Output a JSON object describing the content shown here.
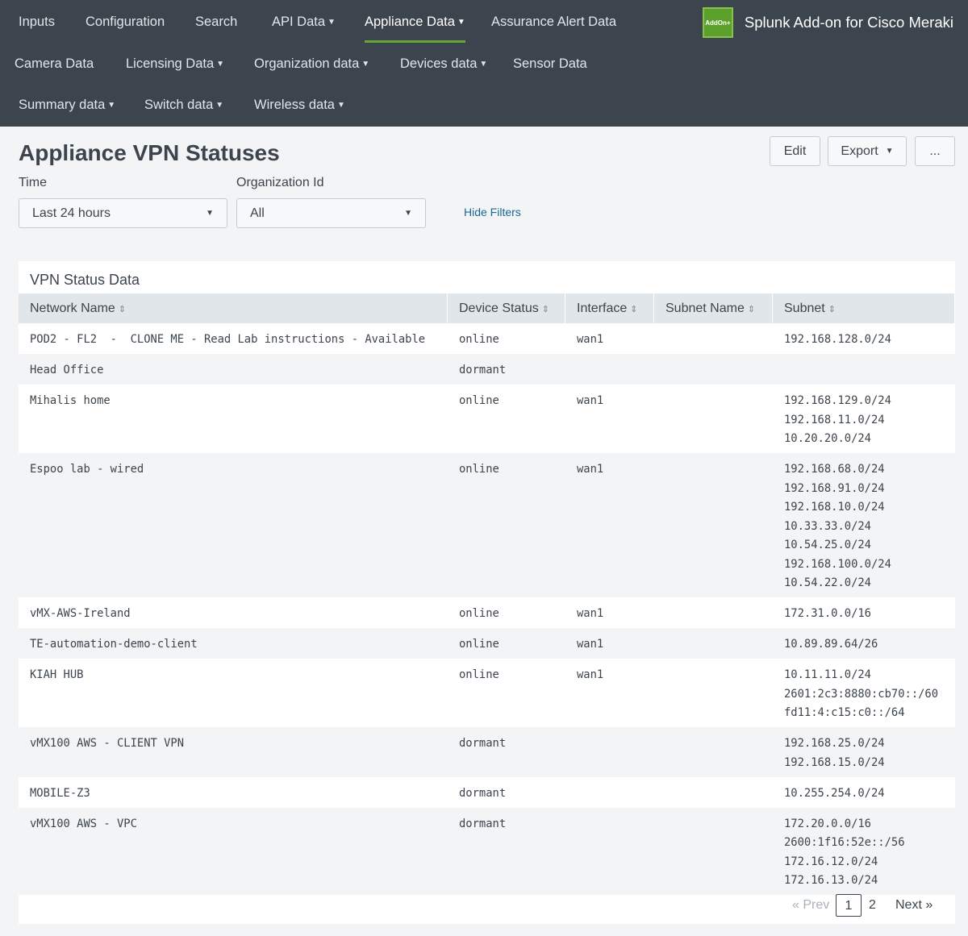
{
  "nav": {
    "row1": [
      {
        "label": "Inputs",
        "caret": false
      },
      {
        "label": "Configuration",
        "caret": false
      },
      {
        "label": "Search",
        "caret": false
      },
      {
        "label": "API Data",
        "caret": true
      },
      {
        "label": "Appliance Data",
        "caret": true,
        "active": true
      },
      {
        "label": "Assurance Alert Data",
        "caret": false
      }
    ],
    "row2": [
      {
        "label": "Camera Data",
        "caret": false
      },
      {
        "label": "Licensing Data",
        "caret": true
      },
      {
        "label": "Organization data",
        "caret": true
      },
      {
        "label": "Devices data",
        "caret": true
      },
      {
        "label": "Sensor Data",
        "caret": false
      }
    ],
    "row3": [
      {
        "label": "Summary data",
        "caret": true
      },
      {
        "label": "Switch data",
        "caret": true
      },
      {
        "label": "Wireless data",
        "caret": true
      }
    ],
    "brand_logo": "AddOn+",
    "brand_name": "Splunk Add-on for Cisco Meraki",
    "accent": "#65a637"
  },
  "header": {
    "title": "Appliance VPN Statuses",
    "edit_label": "Edit",
    "export_label": "Export",
    "more_label": "..."
  },
  "filters": {
    "time_label": "Time",
    "time_value": "Last 24 hours",
    "org_label": "Organization Id",
    "org_value": "All",
    "hide_label": "Hide Filters"
  },
  "panel": {
    "title": "VPN Status Data",
    "columns": [
      "Network Name",
      "Device Status",
      "Interface",
      "Subnet Name",
      "Subnet"
    ],
    "rows": [
      {
        "network": "POD2 - FL2  -  CLONE ME - Read Lab instructions - Available",
        "status": "online",
        "interface": "wan1",
        "subnet_name": "",
        "subnets": [
          "192.168.128.0/24"
        ]
      },
      {
        "network": "Head Office",
        "status": "dormant",
        "interface": "",
        "subnet_name": "",
        "subnets": []
      },
      {
        "network": "Mihalis home",
        "status": "online",
        "interface": "wan1",
        "subnet_name": "",
        "subnets": [
          "192.168.129.0/24",
          "192.168.11.0/24",
          "10.20.20.0/24"
        ]
      },
      {
        "network": "Espoo lab - wired",
        "status": "online",
        "interface": "wan1",
        "subnet_name": "",
        "subnets": [
          "192.168.68.0/24",
          "192.168.91.0/24",
          "192.168.10.0/24",
          "10.33.33.0/24",
          "10.54.25.0/24",
          "192.168.100.0/24",
          "10.54.22.0/24"
        ]
      },
      {
        "network": "vMX-AWS-Ireland",
        "status": "online",
        "interface": "wan1",
        "subnet_name": "",
        "subnets": [
          "172.31.0.0/16"
        ]
      },
      {
        "network": "TE-automation-demo-client",
        "status": "online",
        "interface": "wan1",
        "subnet_name": "",
        "subnets": [
          "10.89.89.64/26"
        ]
      },
      {
        "network": "KIAH HUB",
        "status": "online",
        "interface": "wan1",
        "subnet_name": "",
        "subnets": [
          "10.11.11.0/24",
          "2601:2c3:8880:cb70::/60",
          "fd11:4:c15:c0::/64"
        ]
      },
      {
        "network": "vMX100 AWS - CLIENT VPN",
        "status": "dormant",
        "interface": "",
        "subnet_name": "",
        "subnets": [
          "192.168.25.0/24",
          "192.168.15.0/24"
        ]
      },
      {
        "network": "MOBILE-Z3",
        "status": "dormant",
        "interface": "",
        "subnet_name": "",
        "subnets": [
          "10.255.254.0/24"
        ]
      },
      {
        "network": "vMX100 AWS - VPC",
        "status": "dormant",
        "interface": "",
        "subnet_name": "",
        "subnets": [
          "172.20.0.0/16",
          "2600:1f16:52e::/56",
          "172.16.12.0/24",
          "172.16.13.0/24"
        ]
      }
    ]
  },
  "pagination": {
    "prev_label": "« Prev",
    "pages": [
      "1",
      "2"
    ],
    "current": "1",
    "next_label": "Next »"
  }
}
